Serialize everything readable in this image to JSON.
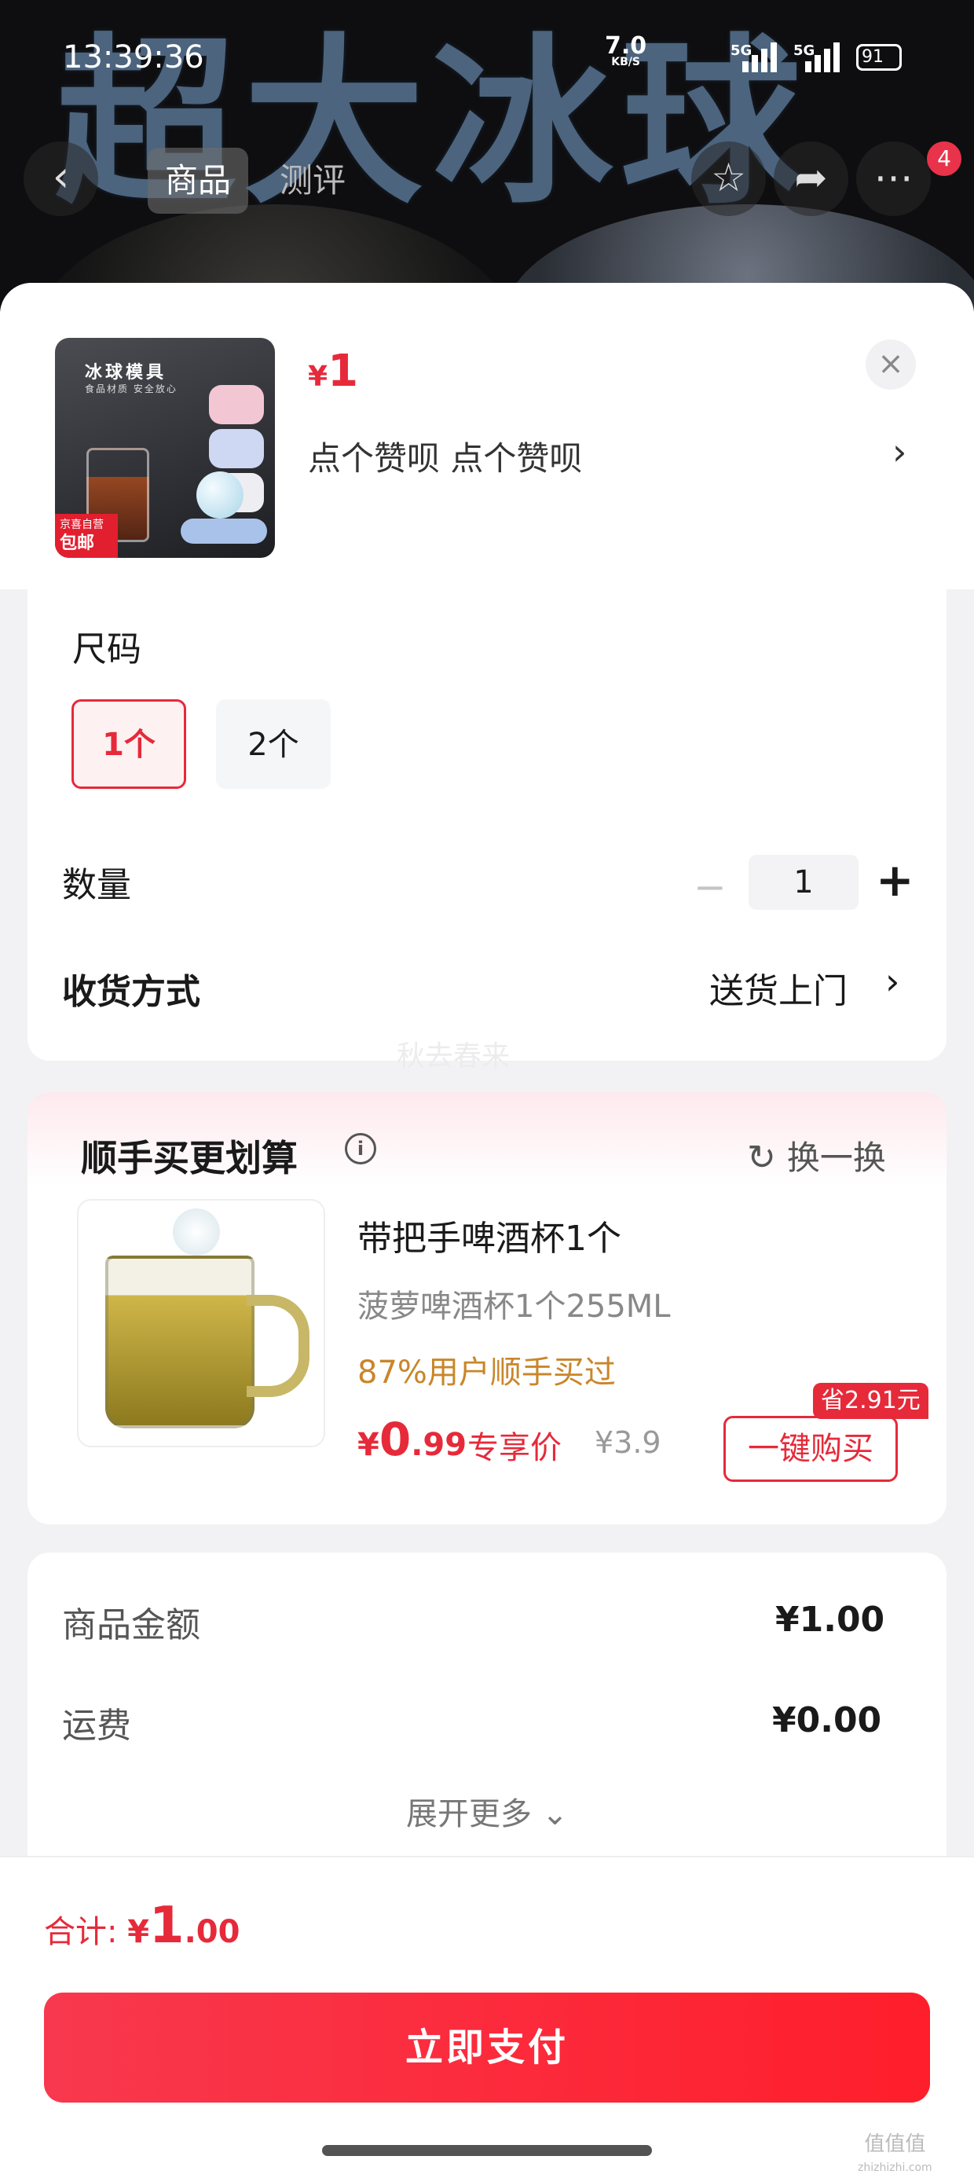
{
  "background": {
    "hero_text": "超大冰球"
  },
  "status_bar": {
    "time": "13:39:36",
    "net_speed": "7.0",
    "net_unit": "KB/S",
    "sim1": "5G",
    "sim2": "5G",
    "battery": "91"
  },
  "nav": {
    "back_icon": "chevron-left-icon",
    "tabs": [
      "商品",
      "测评"
    ],
    "active_tab": "商品",
    "badge_count": "4",
    "icons": [
      "star-icon",
      "share-icon",
      "more-icon"
    ]
  },
  "product": {
    "thumbnail_title": "冰球模具",
    "thumbnail_subtitle": "食品材质 安全放心",
    "thumbnail_tag_top": "京喜自营",
    "thumbnail_tag_main": "包邮",
    "currency": "¥",
    "price": "1",
    "subtitle": "点个赞呗  点个赞呗",
    "subtitle_chevron": "›",
    "close_icon": "×"
  },
  "spec": {
    "size_label": "尺码",
    "options": [
      {
        "label": "1个",
        "selected": true
      },
      {
        "label": "2个",
        "selected": false
      }
    ],
    "qty_label": "数量",
    "qty_minus": "−",
    "qty_value": "1",
    "qty_plus": "+",
    "delivery_label": "收货方式",
    "delivery_value": "送货上门",
    "delivery_chevron": "›",
    "watermark": "秋去春来"
  },
  "upsell": {
    "title": "顺手买更划算",
    "info_icon": "i",
    "swap_icon": "↻",
    "swap_label": "换一换",
    "item": {
      "name": "带把手啤酒杯1个",
      "desc": "菠萝啤酒杯1个255ML",
      "hint": "87%用户顺手买过",
      "currency": "¥",
      "price_int": "0",
      "price_dec": ".99",
      "price_tag": "专享价",
      "old_price": "¥3.9",
      "save_badge": "省2.91元",
      "buy_label": "一键购买"
    }
  },
  "summary": {
    "rows": [
      {
        "label": "商品金额",
        "value": "¥1.00"
      },
      {
        "label": "运费",
        "value": "¥0.00"
      }
    ],
    "expand_label": "展开更多 ⌄"
  },
  "footer": {
    "total_label": "合计: ",
    "total_currency": "¥",
    "total_int": "1",
    "total_dec": ".00",
    "pay_label": "立即支付",
    "corner_mark": "值值值",
    "corner_mark_sub": "zhizhizhi.com"
  },
  "colors": {
    "accent": "#e62a3a",
    "hint": "#c9862a",
    "pay_gradient_start": "#f8384e",
    "pay_gradient_end": "#ff1e2b"
  }
}
